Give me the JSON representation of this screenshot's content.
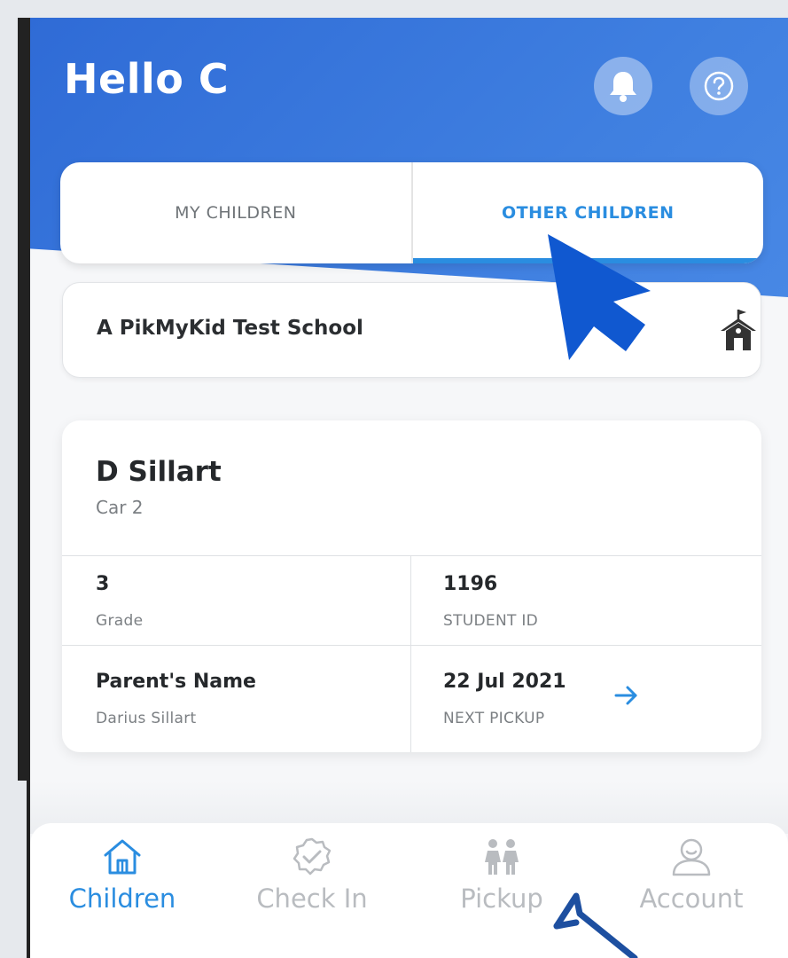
{
  "header": {
    "greeting": "Hello C"
  },
  "tabs": [
    {
      "label": "MY CHILDREN",
      "active": false
    },
    {
      "label": "OTHER CHILDREN",
      "active": true
    }
  ],
  "school": {
    "name": "A PikMyKid Test School",
    "icon": "school-icon"
  },
  "child_card": {
    "name": "D Sillart",
    "car": "Car 2",
    "grade_value": "3",
    "grade_label": "Grade",
    "student_id_value": "1196",
    "student_id_label": "STUDENT ID",
    "parent_label": "Parent's Name",
    "parent_name": "Darius Sillart",
    "next_pickup_value": "22 Jul 2021",
    "next_pickup_label": "NEXT PICKUP"
  },
  "bottom_nav": [
    {
      "label": "Children",
      "icon": "home-icon",
      "active": true
    },
    {
      "label": "Check In",
      "icon": "check-badge-icon",
      "active": false
    },
    {
      "label": "Pickup",
      "icon": "family-icon",
      "active": false
    },
    {
      "label": "Account",
      "icon": "user-icon",
      "active": false
    }
  ],
  "colors": {
    "primary": "#2f6bd6",
    "accent": "#2a8de0",
    "inactive": "#b9bcc0"
  }
}
